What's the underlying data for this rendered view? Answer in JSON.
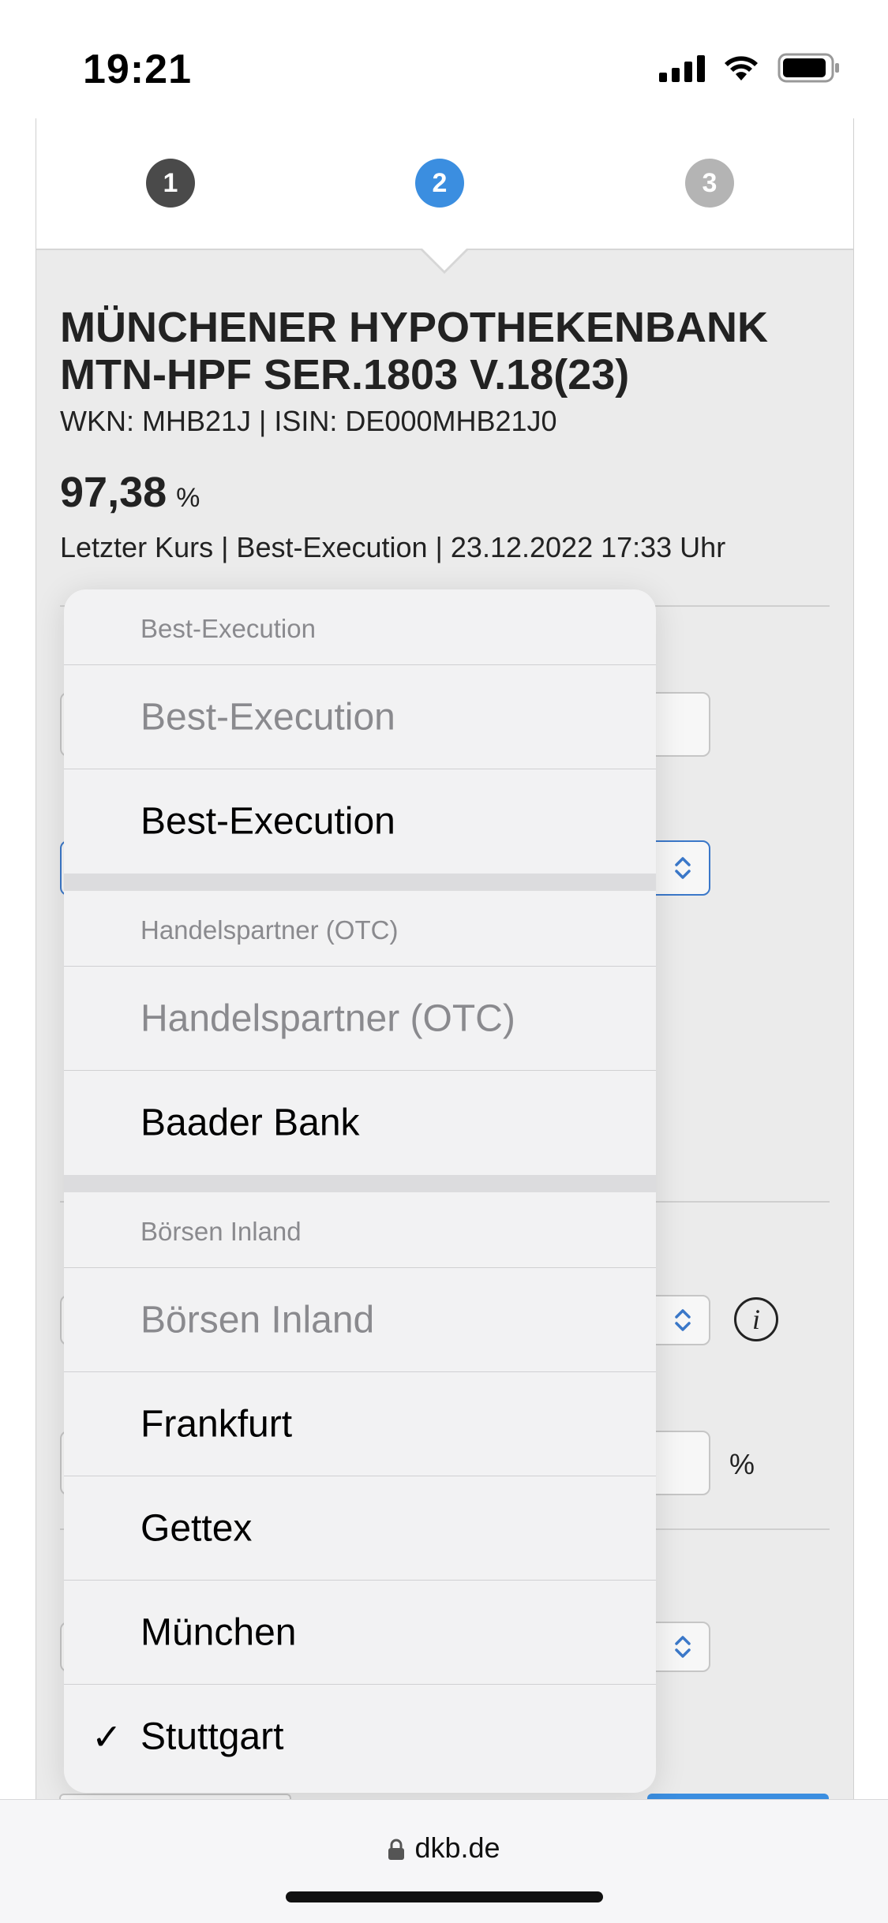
{
  "status_bar": {
    "time": "19:21"
  },
  "stepper": {
    "steps": [
      "1",
      "2",
      "3"
    ],
    "active": 2
  },
  "security": {
    "title_line1": "MÜNCHENER HYPOTHEKENBANK",
    "title_line2": "MTN-HPF SER.1803 V.18(23)",
    "identifiers": "WKN: MHB21J | ISIN: DE000MHB21J0",
    "price": "97,38",
    "price_unit": "%",
    "price_info": "Letzter Kurs | Best-Execution | 23.12.2022 17:33 Uhr"
  },
  "form_background": {
    "percent_unit": "%"
  },
  "picker": {
    "sections": [
      {
        "header": "Best-Execution",
        "options": [
          {
            "label": "Best-Execution",
            "disabled": true,
            "selected": false
          },
          {
            "label": "Best-Execution",
            "disabled": false,
            "selected": false
          }
        ]
      },
      {
        "header": "Handelspartner (OTC)",
        "options": [
          {
            "label": "Handelspartner (OTC)",
            "disabled": true,
            "selected": false
          },
          {
            "label": "Baader Bank",
            "disabled": false,
            "selected": false
          }
        ]
      },
      {
        "header": "Börsen Inland",
        "options": [
          {
            "label": "Börsen Inland",
            "disabled": true,
            "selected": false
          },
          {
            "label": "Frankfurt",
            "disabled": false,
            "selected": false
          },
          {
            "label": "Gettex",
            "disabled": false,
            "selected": false
          },
          {
            "label": "München",
            "disabled": false,
            "selected": false
          },
          {
            "label": "Stuttgart",
            "disabled": false,
            "selected": true
          }
        ]
      }
    ],
    "check_glyph": "✓"
  },
  "browser": {
    "url": "dkb.de"
  },
  "colors": {
    "accent": "#3b8ee0",
    "step_done": "#4a4a4a",
    "step_todo": "#b4b4b4"
  }
}
